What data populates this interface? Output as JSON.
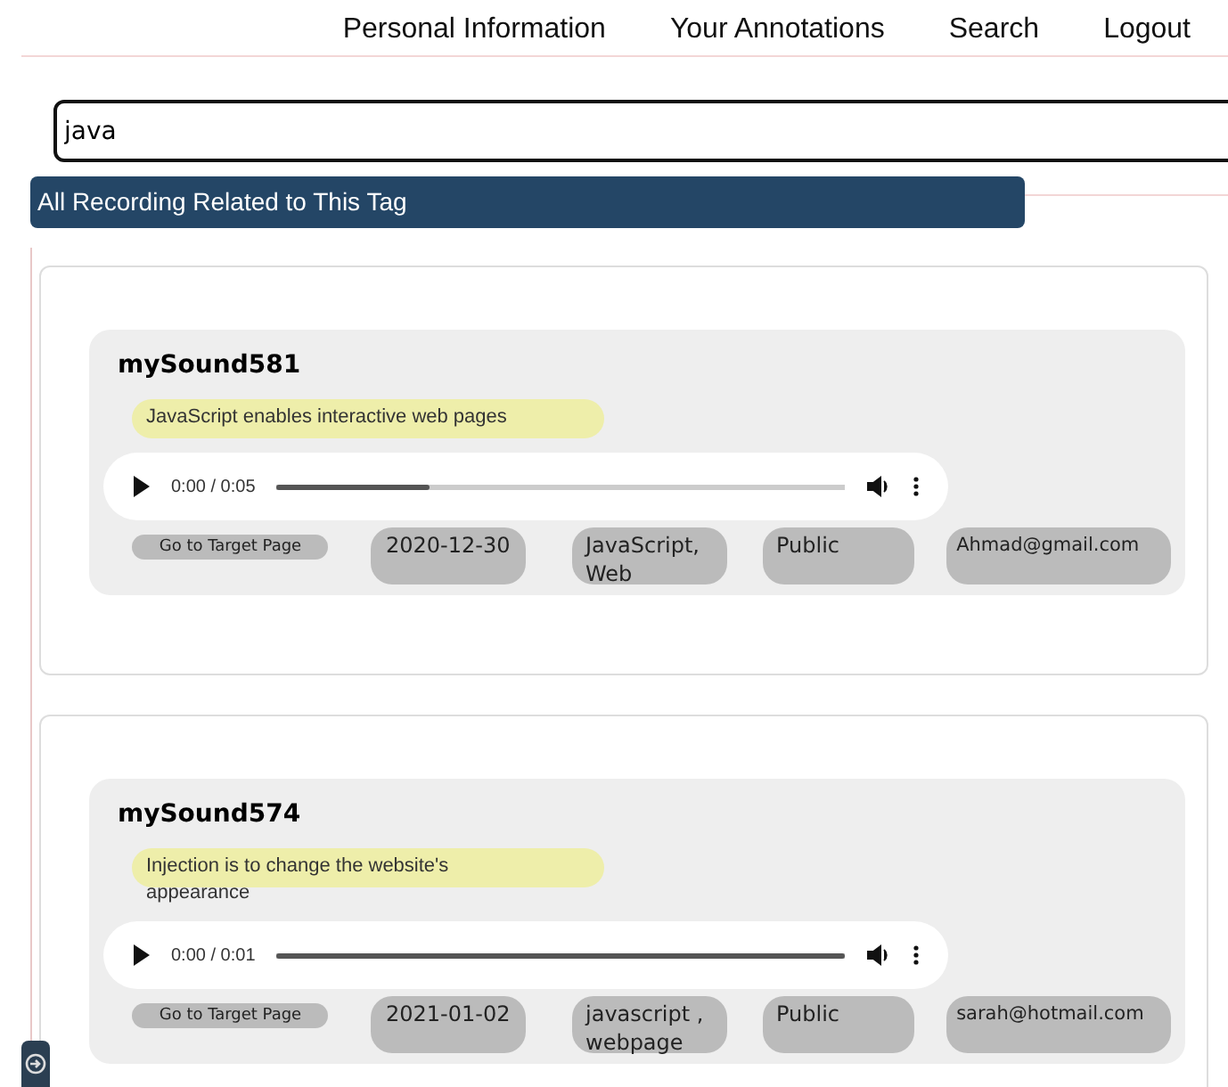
{
  "nav": [
    "Personal Information",
    "Your Annotations",
    "Search",
    "Logout"
  ],
  "search": {
    "value": "java"
  },
  "section_title": "All Recording Related to This Tag",
  "recordings": [
    {
      "title": "mySound581",
      "annotation": "JavaScript enables interactive web pages",
      "player": {
        "time": "0:00 / 0:05",
        "level": 0.27
      },
      "link": "Go to Target Page",
      "date": "2020-12-30",
      "tags": "JavaScript, Web",
      "visibility": "Public",
      "email": "Ahmad@gmail.com"
    },
    {
      "title": "mySound574",
      "annotation": "Injection is to change the website's appearance",
      "player": {
        "time": "0:00 / 0:01",
        "level": 1
      },
      "link": "Go to Target Page",
      "date": "2021-01-02",
      "tags": "javascript , webpage",
      "visibility": "Public",
      "email": "sarah@hotmail.com"
    }
  ]
}
